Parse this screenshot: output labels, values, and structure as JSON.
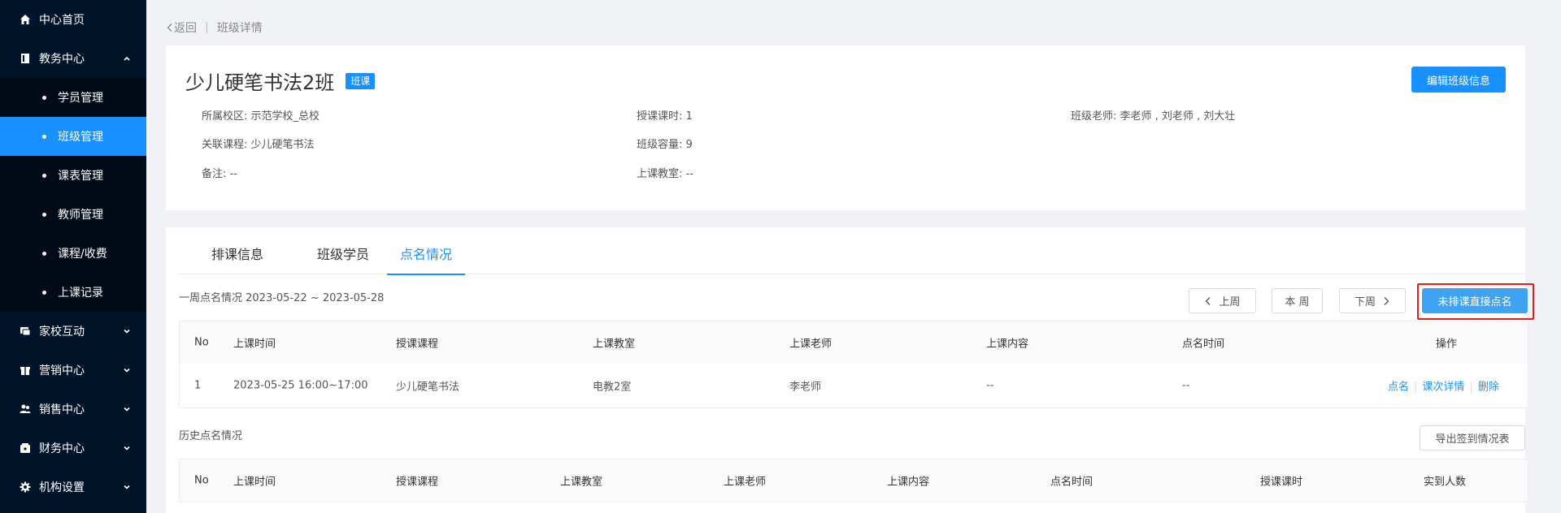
{
  "sidebar": {
    "home": "中心首页",
    "jiaowu": "教务中心",
    "sub_items": [
      "学员管理",
      "班级管理",
      "课表管理",
      "教师管理",
      "课程/收费",
      "上课记录"
    ],
    "jiaxiao": "家校互动",
    "yingxiao": "营销中心",
    "xiaoshou": "销售中心",
    "caiwu": "财务中心",
    "jigou": "机构设置"
  },
  "breadcrumb": {
    "back": "返回",
    "current": "班级详情"
  },
  "class": {
    "title": "少儿硬笔书法2班",
    "badge": "班课",
    "edit_button": "编辑班级信息",
    "campus": "所属校区: 示范学校_总校",
    "course": "关联课程: 少儿硬笔书法",
    "note": "备注: --",
    "hours": "授课课时: 1",
    "capacity": "班级容量: 9",
    "room": "上课教室: --",
    "teachers": "班级老师:  李老师 , 刘老师 , 刘大壮"
  },
  "tabs": [
    "排课信息",
    "班级学员",
    "点名情况"
  ],
  "week": {
    "label": "一周点名情况 2023-05-22 ~ 2023-05-28",
    "prev": "上周",
    "this": "本 周",
    "next": "下周",
    "direct": "未排课直接点名"
  },
  "week_table": {
    "headers": [
      "No",
      "上课时间",
      "授课课程",
      "上课教室",
      "上课老师",
      "上课内容",
      "点名时间",
      "操作"
    ],
    "rows": [
      {
        "no": "1",
        "time": "2023-05-25 16:00~17:00",
        "course": "少儿硬笔书法",
        "room": "电教2室",
        "teacher": "李老师",
        "content": "--",
        "rollcall": "--",
        "actions": [
          "点名",
          "课次详情",
          "删除"
        ]
      }
    ]
  },
  "history": {
    "label": "历史点名情况",
    "export": "导出签到情况表",
    "headers": [
      "No",
      "上课时间",
      "授课课程",
      "上课教室",
      "上课老师",
      "上课内容",
      "点名时间",
      "授课课时",
      "实到人数"
    ]
  }
}
